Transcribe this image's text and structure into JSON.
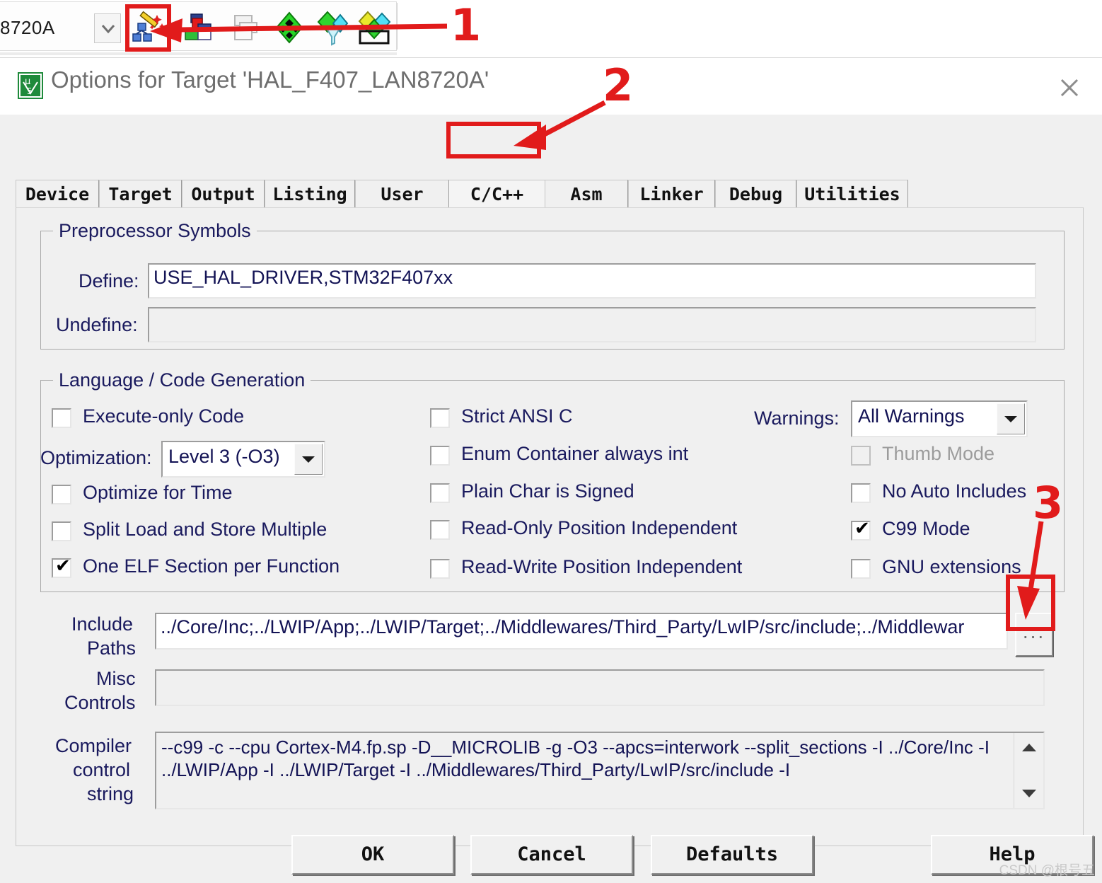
{
  "toolbar": {
    "target_combo_value": "8720A",
    "combo_arrow_icon": "chevron-down-icon",
    "icons": [
      {
        "name": "configuration-wizard-icon",
        "title": "Configuration Wizard"
      },
      {
        "name": "manage-run-time-environment-icon",
        "title": "Manage Run-Time Environment"
      },
      {
        "name": "manage-project-items-icon",
        "title": "Manage Project Items"
      },
      {
        "name": "multi-project-icon",
        "title": "Multi-Project"
      },
      {
        "name": "pack-installer-icon",
        "title": "Pack Installer"
      },
      {
        "name": "batch-build-icon",
        "title": "Batch Build"
      }
    ]
  },
  "dialog": {
    "title": "Options for Target 'HAL_F407_LAN8720A'",
    "app_icon": "keil-uvision5-icon",
    "close_icon": "close-icon",
    "close_label": "✕"
  },
  "tabs": [
    {
      "label": "Device",
      "active": false
    },
    {
      "label": "Target",
      "active": false
    },
    {
      "label": "Output",
      "active": false
    },
    {
      "label": "Listing",
      "active": false
    },
    {
      "label": "User",
      "active": false
    },
    {
      "label": "C/C++",
      "active": true
    },
    {
      "label": "Asm",
      "active": false
    },
    {
      "label": "Linker",
      "active": false
    },
    {
      "label": "Debug",
      "active": false
    },
    {
      "label": "Utilities",
      "active": false
    }
  ],
  "preprocessor": {
    "legend": "Preprocessor Symbols",
    "define_label": "Define:",
    "define_value": "USE_HAL_DRIVER,STM32F407xx",
    "undefine_label": "Undefine:",
    "undefine_value": ""
  },
  "language": {
    "legend": "Language / Code Generation",
    "optimization_label": "Optimization:",
    "optimization_value": "Level 3 (-O3)",
    "warnings_label": "Warnings:",
    "warnings_value": "All Warnings",
    "col1": [
      {
        "label": "Execute-only Code",
        "checked": false,
        "disabled": false
      },
      {
        "label": "Optimize for Time",
        "checked": false,
        "disabled": false
      },
      {
        "label": "Split Load and Store Multiple",
        "checked": false,
        "disabled": false
      },
      {
        "label": "One ELF Section per Function",
        "checked": true,
        "disabled": false
      }
    ],
    "col2": [
      {
        "label": "Strict ANSI C",
        "checked": false,
        "disabled": false
      },
      {
        "label": "Enum Container always int",
        "checked": false,
        "disabled": false
      },
      {
        "label": "Plain Char is Signed",
        "checked": false,
        "disabled": false
      },
      {
        "label": "Read-Only Position Independent",
        "checked": false,
        "disabled": false
      },
      {
        "label": "Read-Write Position Independent",
        "checked": false,
        "disabled": false
      }
    ],
    "col3": [
      {
        "label": "Thumb Mode",
        "checked": false,
        "disabled": true
      },
      {
        "label": "No Auto Includes",
        "checked": false,
        "disabled": false
      },
      {
        "label": "C99 Mode",
        "checked": true,
        "disabled": false
      },
      {
        "label": "GNU extensions",
        "checked": false,
        "disabled": false
      }
    ]
  },
  "paths": {
    "include_label_line1": "Include",
    "include_label_line2": "Paths",
    "include_value": "../Core/Inc;../LWIP/App;../LWIP/Target;../Middlewares/Third_Party/LwIP/src/include;../Middlewar",
    "browse_label": "...",
    "misc_label_line1": "Misc",
    "misc_label_line2": "Controls",
    "misc_value": "",
    "compiler_label_line1": "Compiler",
    "compiler_label_line2": "control",
    "compiler_label_line3": "string",
    "compiler_value_line1": "--c99 -c --cpu Cortex-M4.fp.sp -D__MICROLIB -g -O3 --apcs=interwork --split_sections -I ../Core/Inc -I",
    "compiler_value_line2": "../LWIP/App -I ../LWIP/Target -I ../Middlewares/Third_Party/LwIP/src/include -I",
    "scroll_up_icon": "scroll-up-arrow-icon",
    "scroll_down_icon": "scroll-down-arrow-icon"
  },
  "buttons": {
    "ok": "OK",
    "cancel": "Cancel",
    "defaults": "Defaults",
    "help": "Help"
  },
  "annotations": {
    "one": "1",
    "two": "2",
    "three": "3",
    "accent_color": "#e11b1b"
  },
  "watermark": "CSDN @根号五"
}
